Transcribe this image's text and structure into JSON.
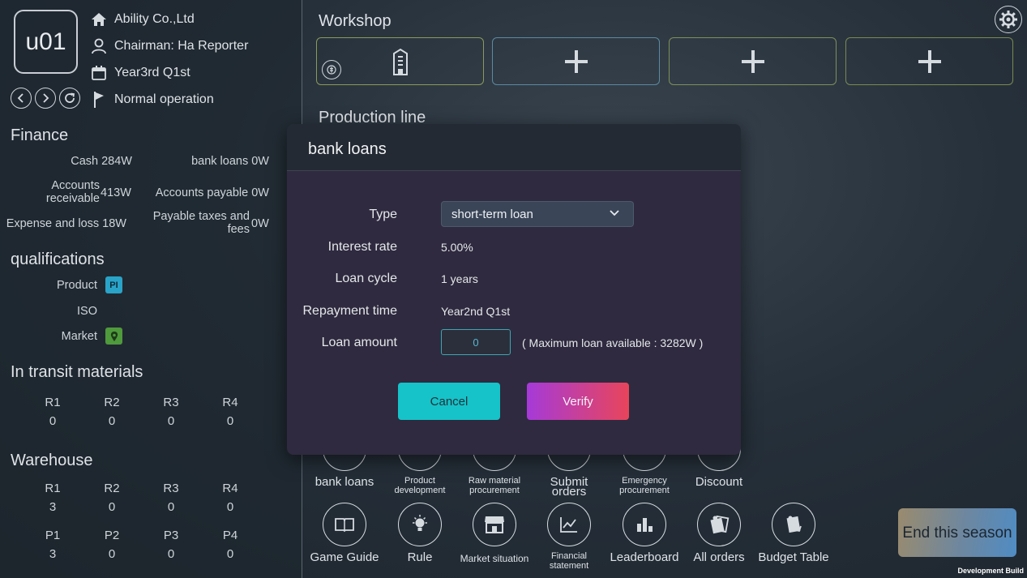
{
  "company": {
    "avatar_text": "u01",
    "name": "Ability Co.,Ltd",
    "chairman": "Chairman:  Ha Reporter",
    "period": "Year3rd  Q1st",
    "status": "Normal operation"
  },
  "finance": {
    "title": "Finance",
    "cash": "Cash 284W",
    "bank_loans": "bank loans 0W",
    "accounts_receivable_label": "Accounts receivable",
    "accounts_receivable_value": "413W",
    "accounts_payable": "Accounts payable 0W",
    "expense_and_loss": "Expense and loss 18W",
    "payable_taxes_label": "Payable taxes and fees",
    "payable_taxes_value": "0W"
  },
  "qualifications": {
    "title": "qualifications",
    "product_label": "Product",
    "product_badge": "PI",
    "iso_label": "ISO",
    "market_label": "Market"
  },
  "in_transit": {
    "title": "In transit materials",
    "items": [
      {
        "name": "R1",
        "value": "0"
      },
      {
        "name": "R2",
        "value": "0"
      },
      {
        "name": "R3",
        "value": "0"
      },
      {
        "name": "R4",
        "value": "0"
      }
    ]
  },
  "warehouse": {
    "title": "Warehouse",
    "raw": [
      {
        "name": "R1",
        "value": "3"
      },
      {
        "name": "R2",
        "value": "0"
      },
      {
        "name": "R3",
        "value": "0"
      },
      {
        "name": "R4",
        "value": "0"
      }
    ],
    "products": [
      {
        "name": "P1",
        "value": "3"
      },
      {
        "name": "P2",
        "value": "0"
      },
      {
        "name": "P3",
        "value": "0"
      },
      {
        "name": "P4",
        "value": "0"
      }
    ]
  },
  "workshop": {
    "title": "Workshop",
    "production_line_title": "Production line",
    "slot_colors": [
      "#8a9a5a",
      "#5c8aa0",
      "#7e9058",
      "#7a8a50"
    ]
  },
  "toolbar_row1": [
    {
      "label": "bank loans",
      "small": false
    },
    {
      "label": "Product development",
      "small": true
    },
    {
      "label": "Raw material procurement",
      "small": true
    },
    {
      "label": "Submit orders",
      "small": false
    },
    {
      "label": "Emergency procurement",
      "small": true
    },
    {
      "label": "Discount",
      "small": false
    }
  ],
  "toolbar_row2": [
    {
      "label": "Game Guide",
      "icon": "book-icon",
      "small": false
    },
    {
      "label": "Rule",
      "icon": "lightbulb-icon",
      "small": false
    },
    {
      "label": "Market situation",
      "icon": "shop-icon",
      "small": true
    },
    {
      "label": "Financial statement",
      "icon": "line-chart-icon",
      "small": true
    },
    {
      "label": "Leaderboard",
      "icon": "bar-chart-icon",
      "small": false
    },
    {
      "label": "All orders",
      "icon": "orders-icon",
      "small": false
    },
    {
      "label": "Budget Table",
      "icon": "budget-icon",
      "small": false
    }
  ],
  "end_season": "End this season",
  "dev_build": "Development Build",
  "modal": {
    "title": "bank loans",
    "type_label": "Type",
    "type_value": "short-term loan",
    "interest_label": "Interest rate",
    "interest_value": "5.00%",
    "cycle_label": "Loan cycle",
    "cycle_value": "1 years",
    "repayment_label": "Repayment time",
    "repayment_value": "Year2nd  Q1st",
    "amount_label": "Loan amount",
    "amount_value": "0",
    "max_note": "( Maximum loan available : 3282W )",
    "cancel": "Cancel",
    "verify": "Verify"
  },
  "colors": {
    "cancel": "#15c3c9",
    "verify_start": "#a63ad8",
    "verify_end": "#e8455a",
    "product_badge": "#2aa3c8",
    "market_badge": "#4f9a3c"
  }
}
